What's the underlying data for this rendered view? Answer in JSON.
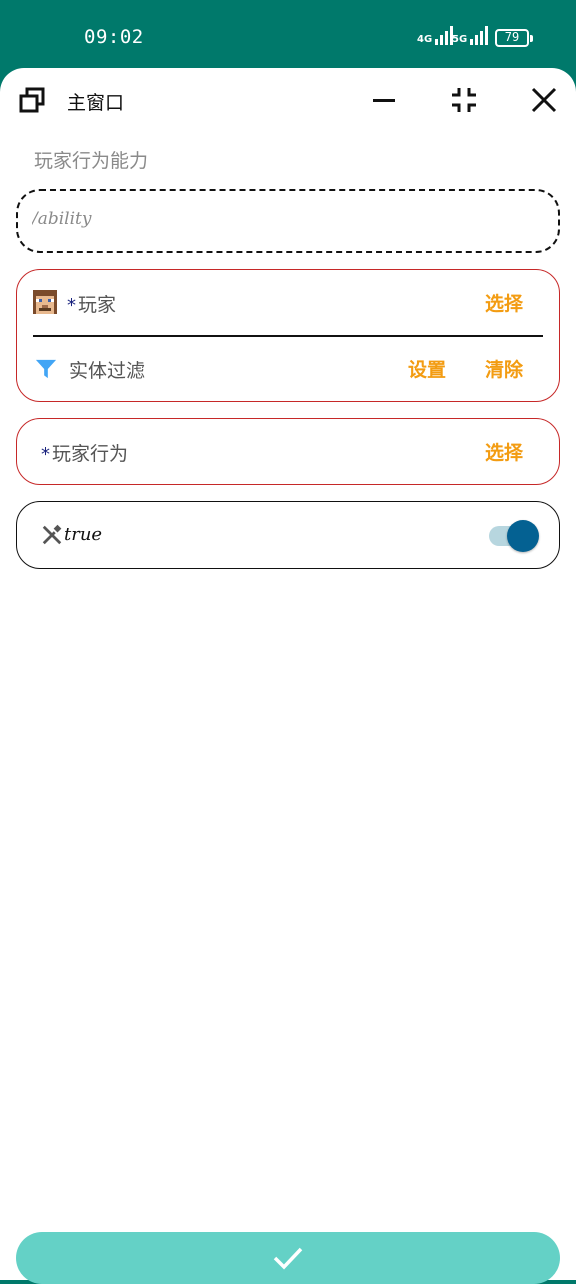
{
  "status_bar": {
    "time": "09:02",
    "network1": "4G",
    "network2": "5G",
    "battery": "79"
  },
  "window": {
    "title": "主窗口",
    "section_label": "玩家行为能力",
    "command_value": "/ability"
  },
  "player_card": {
    "required_mark": "*",
    "player_label": "玩家",
    "select_label": "选择",
    "filter_label": "实体过滤",
    "set_label": "设置",
    "clear_label": "清除"
  },
  "action_card": {
    "required_mark": "*",
    "action_label": "玩家行为",
    "select_label": "选择"
  },
  "toggle_card": {
    "value_label": "true",
    "toggle_on": true
  },
  "colors": {
    "header_bg": "#00796b",
    "accent_orange": "#f39c12",
    "required_blue": "#1a237e",
    "error_red": "#c62828",
    "switch_knob": "#046192",
    "confirm_bg": "#64d1c6"
  },
  "icons": {
    "window": "restore-window-icon",
    "minimize": "minimize-icon",
    "collapse": "collapse-icon",
    "close": "close-icon",
    "player": "player-avatar-icon",
    "filter": "filter-icon",
    "tool": "tool-icon",
    "confirm": "check-icon"
  }
}
